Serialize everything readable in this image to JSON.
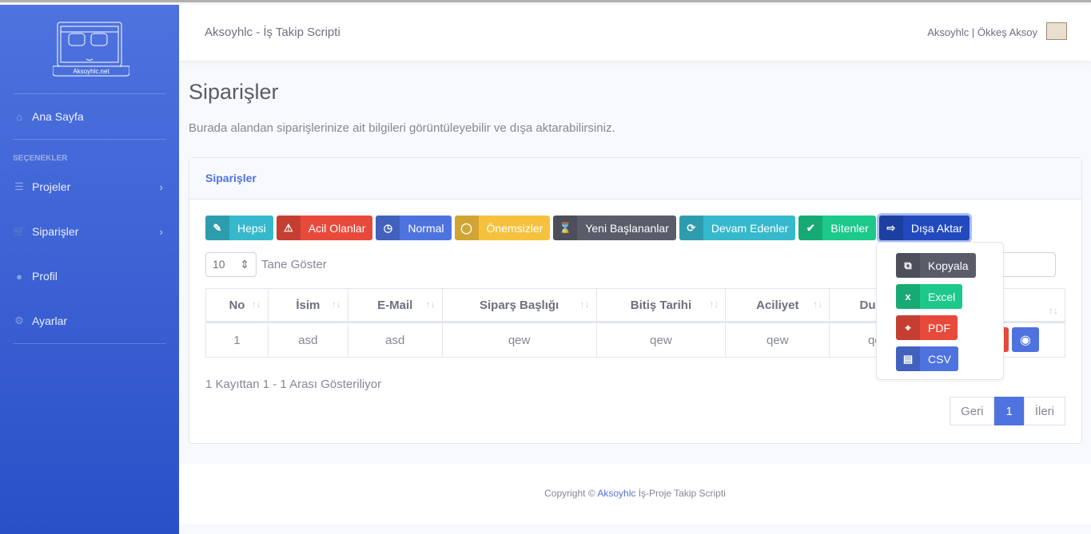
{
  "sidebar": {
    "logo_text": "Aksoyhlc.net",
    "items": [
      {
        "label": "Ana Sayfa",
        "icon": "home-icon"
      },
      {
        "label": "Projeler",
        "icon": "tasks-icon"
      },
      {
        "label": "Siparişler",
        "icon": "cart-icon"
      },
      {
        "label": "Profil",
        "icon": "user-circle-icon"
      },
      {
        "label": "Ayarlar",
        "icon": "gear-icon"
      }
    ],
    "section": "SEÇENEKLER"
  },
  "header": {
    "title": "Aksoyhlc - İş Takip Scripti",
    "user": "Aksoyhlc | Ökkeş Aksoy"
  },
  "page": {
    "title": "Siparişler",
    "description": "Burada alandan siparişlerinize ait bilgileri görüntüleyebilir ve dışa aktarabilirsiniz."
  },
  "card": {
    "title": "Siparişler",
    "filters": [
      {
        "label": "Hepsi",
        "color": "#36b9cc",
        "icon": "✎"
      },
      {
        "label": "Acil Olanlar",
        "color": "#e74a3b",
        "icon": "⚠"
      },
      {
        "label": "Normal",
        "color": "#4e73df",
        "icon": "◷"
      },
      {
        "label": "Önemsizler",
        "color": "#f6c23e",
        "icon": "◯"
      },
      {
        "label": "Yeni Başlananlar",
        "color": "#5a5c69",
        "icon": "⌛"
      },
      {
        "label": "Devam Edenler",
        "color": "#36b9cc",
        "icon": "⟳"
      },
      {
        "label": "Bitenler",
        "color": "#1cc88a",
        "icon": "✔"
      },
      {
        "label": "Dışa Aktar",
        "color": "#224abe",
        "icon": "⇨"
      }
    ],
    "length": {
      "value": "10",
      "label": "Tane Göster"
    },
    "columns": [
      "No",
      "İsim",
      "E-Mail",
      "Siparş Başlığı",
      "Bitiş Tarihi",
      "Aciliyet",
      "Durum",
      ""
    ],
    "rows": [
      [
        "1",
        "asd",
        "asd",
        "qew",
        "qew",
        "qew",
        "qew"
      ]
    ],
    "info": "1 Kayıttan 1 - 1 Arası Gösteriliyor",
    "pagination": {
      "prev": "Geri",
      "current": "1",
      "next": "İleri"
    },
    "export_menu": [
      {
        "label": "Kopyala",
        "color": "#5a5c69"
      },
      {
        "label": "Excel",
        "color": "#1cc88a"
      },
      {
        "label": "PDF",
        "color": "#e74a3b"
      },
      {
        "label": "CSV",
        "color": "#4e73df"
      }
    ]
  },
  "footer": {
    "prefix": "Copyright © ",
    "link": "Aksoyhlc",
    "suffix": " İş-Proje Takip Scripti"
  }
}
